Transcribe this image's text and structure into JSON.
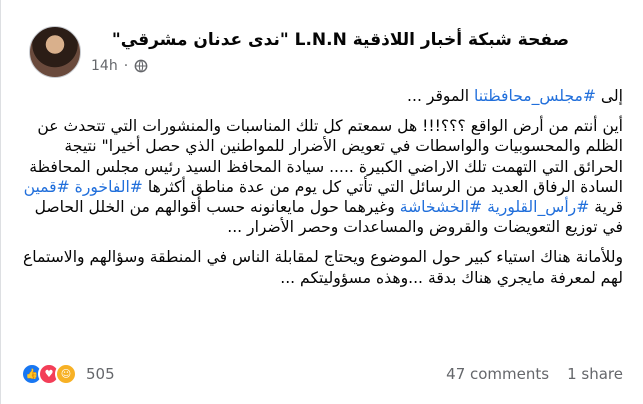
{
  "post": {
    "author": "صفحة شبكة أخبار اللاذقية L.N.N \"ندى عدنان مشرقي\"",
    "time": "14h",
    "more": "···",
    "paragraphs": [
      [
        {
          "text": "إلى ",
          "type": "text"
        },
        {
          "text": "#مجلس_محافظتنا",
          "type": "tag"
        },
        {
          "text": " الموقر ...",
          "type": "text"
        }
      ],
      [
        {
          "text": "أين أنتم من أرض الواقع ؟؟؟!!! هل سمعتم كل تلك المناسبات والمنشورات التي تتحدث عن الظلم والمحسوبيات والواسطات في تعويض الأضرار للمواطنين الذي حصل أخيرا\" نتيجة الحرائق التي التهمت تلك الاراضي الكبيرة ..... سيادة المحافظ السيد رئيس مجلس المحافظة السادة الرفاق العديد من الرسائل التي تأتي كل يوم من عدة مناطق أكثرها ",
          "type": "text"
        },
        {
          "text": "#الفاخورة",
          "type": "tag"
        },
        {
          "text": " ",
          "type": "text"
        },
        {
          "text": "#قمين",
          "type": "tag"
        },
        {
          "text": " قرية ",
          "type": "text"
        },
        {
          "text": "#رأس_القلورية",
          "type": "tag"
        },
        {
          "text": " ",
          "type": "text"
        },
        {
          "text": "#الخشخاشة",
          "type": "tag"
        },
        {
          "text": " وغيرهما حول مايعانونه حسب أقوالهم من الخلل الحاصل في توزيع التعويضات والقروض والمساعدات وحصر الأضرار ...",
          "type": "text"
        }
      ],
      [
        {
          "text": "وللأمانة هناك استياء كبير حول الموضوع ويحتاج لمقابلة الناس في المنطقة وسؤالهم والاستماع لهم لمعرفة مايجري هناك بدقة ...وهذه مسؤوليتكم ...",
          "type": "text"
        }
      ]
    ]
  },
  "stats": {
    "reaction_count": "505",
    "comments": "47 comments",
    "shares": "1 share",
    "reactions": [
      "like-icon",
      "love-icon",
      "care-icon"
    ]
  },
  "colors": {
    "hashtag": "#216fdb",
    "like": "#1877f2",
    "love": "#f33e58",
    "care": "#f7b125"
  }
}
